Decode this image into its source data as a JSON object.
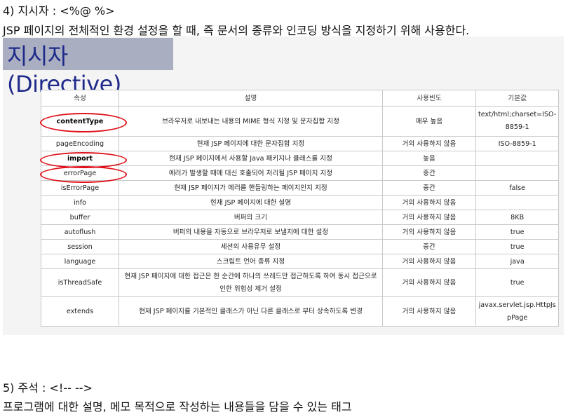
{
  "section4": {
    "heading": "4) 지시자 : <%@ %>",
    "description": "JSP 페이지의 전체적인 환경 설정을 할 때, 즉 문서의 종류와 인코딩 방식을 지정하기 위해 사용한다."
  },
  "banner": {
    "title": "지시자(Directive)"
  },
  "table": {
    "headers": [
      "속성",
      "설명",
      "사용빈도",
      "기본값"
    ],
    "rows": [
      {
        "attr": "contentType",
        "desc": "브라우저로 내보내는 내용의 MIME 형식 지정 및 문자집합 지정",
        "freq": "매우 높음",
        "default": "text/html;charset=ISO-8859-1"
      },
      {
        "attr": "pageEncoding",
        "desc": "현재 JSP 페이지에 대한 문자집합 지정",
        "freq": "거의 사용하지 않음",
        "default": "ISO-8859-1"
      },
      {
        "attr": "import",
        "desc": "현재 JSP 페이지에서 사용할 Java 패키지나 클래스를 지정",
        "freq": "높음",
        "default": ""
      },
      {
        "attr": "errorPage",
        "desc": "에러가 발생할 때에 대신 호출되어 처리될 JSP 페이지 지정",
        "freq": "중간",
        "default": ""
      },
      {
        "attr": "isErrorPage",
        "desc": "현재 JSP 페이지가 에러를 핸들링하는 페이지인지 지정",
        "freq": "중간",
        "default": "false"
      },
      {
        "attr": "info",
        "desc": "현재 JSP 페이지에 대한 설명",
        "freq": "거의 사용하지 않음",
        "default": ""
      },
      {
        "attr": "buffer",
        "desc": "버퍼의 크기",
        "freq": "거의 사용하지 않음",
        "default": "8KB"
      },
      {
        "attr": "autoflush",
        "desc": "버퍼의 내용을 자동으로 브라우저로 보낼지에 대한 설정",
        "freq": "거의 사용하지 않음",
        "default": "true"
      },
      {
        "attr": "session",
        "desc": "세션의 사용유무 설정",
        "freq": "중간",
        "default": "true"
      },
      {
        "attr": "language",
        "desc": "스크립트 언어 종류 지정",
        "freq": "거의 사용하지 않음",
        "default": "java"
      },
      {
        "attr": "isThreadSafe",
        "desc": "현재 JSP 페이지에 대한 접근은 한 순간에 하나의 쓰레드만 접근하도록 하여 동시 접근으로 인한 위험성 제거 설정",
        "freq": "거의 사용하지 않음",
        "default": "true"
      },
      {
        "attr": "extends",
        "desc": "현재 JSP 페이지를 기본적인 클래스가 아닌 다른 클래스로 부터 상속하도록 변경",
        "freq": "거의 사용하지 않음",
        "default": "javax.servlet.jsp.HttpJspPage"
      }
    ]
  },
  "section5": {
    "heading": "5) 주석 : <!-- -->",
    "description": "프로그램에 대한 설명, 메모 목적으로 작성하는 내용들을 담을 수 있는 태그"
  },
  "highlight_color": "#e0101a",
  "banner_color": "#a9aec0"
}
